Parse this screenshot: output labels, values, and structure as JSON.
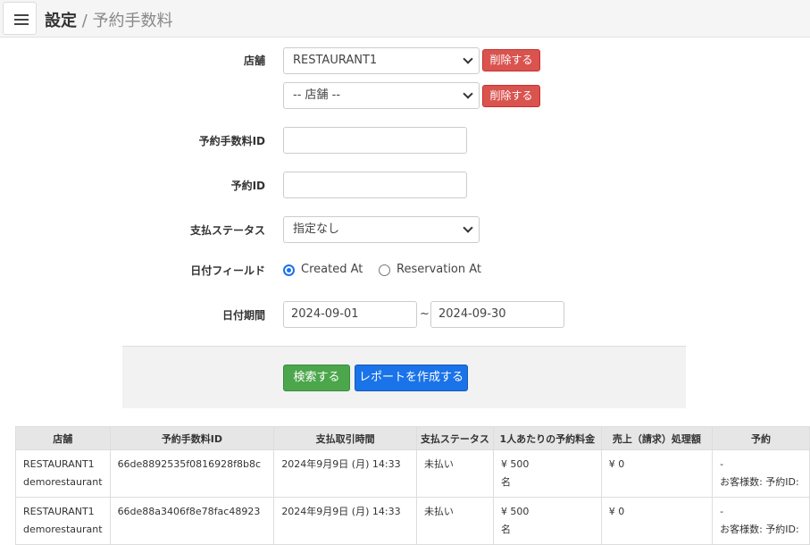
{
  "header": {
    "current": "設定",
    "separator": "/",
    "page": "予約手数料"
  },
  "form": {
    "store_label": "店舗",
    "store_select_1": "RESTAURANT1",
    "store_select_2": "-- 店舗 --",
    "delete_label": "削除する",
    "fee_id_label": "予約手数料ID",
    "fee_id_value": "",
    "reservation_id_label": "予約ID",
    "reservation_id_value": "",
    "payment_status_label": "支払ステータス",
    "payment_status_value": "指定なし",
    "date_field_label": "日付フィールド",
    "date_field_option_1": "Created At",
    "date_field_option_2": "Reservation At",
    "date_field_selected": "Created At",
    "date_range_label": "日付期間",
    "date_from": "2024-09-01",
    "date_sep": "~",
    "date_to": "2024-09-30",
    "search_label": "検索する",
    "report_label": "レポートを作成する"
  },
  "table": {
    "headers": [
      "店舗",
      "予約手数料ID",
      "支払取引時間",
      "支払ステータス",
      "1人あたりの予約料金",
      "売上（請求）処理額",
      "予約"
    ],
    "rows": [
      {
        "store": "RESTAURANT1",
        "store_sub": "demorestaurant",
        "fee_id": "66de8892535f0816928f8b8c",
        "time": "2024年9月9日 (月) 14:33",
        "status": "未払い",
        "fee": "¥ 500",
        "fee_sub": "名",
        "amount": "¥ 0",
        "reservation": "-",
        "reservation_sub": "お客様数: 予約ID:"
      },
      {
        "store": "RESTAURANT1",
        "store_sub": "demorestaurant",
        "fee_id": "66de88a3406f8e78fac48923",
        "time": "2024年9月9日 (月) 14:33",
        "status": "未払い",
        "fee": "¥ 500",
        "fee_sub": "名",
        "amount": "¥ 0",
        "reservation": "-",
        "reservation_sub": "お客様数: 予約ID:"
      }
    ]
  },
  "colors": {
    "danger": "#d9534f",
    "success": "#4ca64c",
    "primary": "#1a73e8"
  }
}
